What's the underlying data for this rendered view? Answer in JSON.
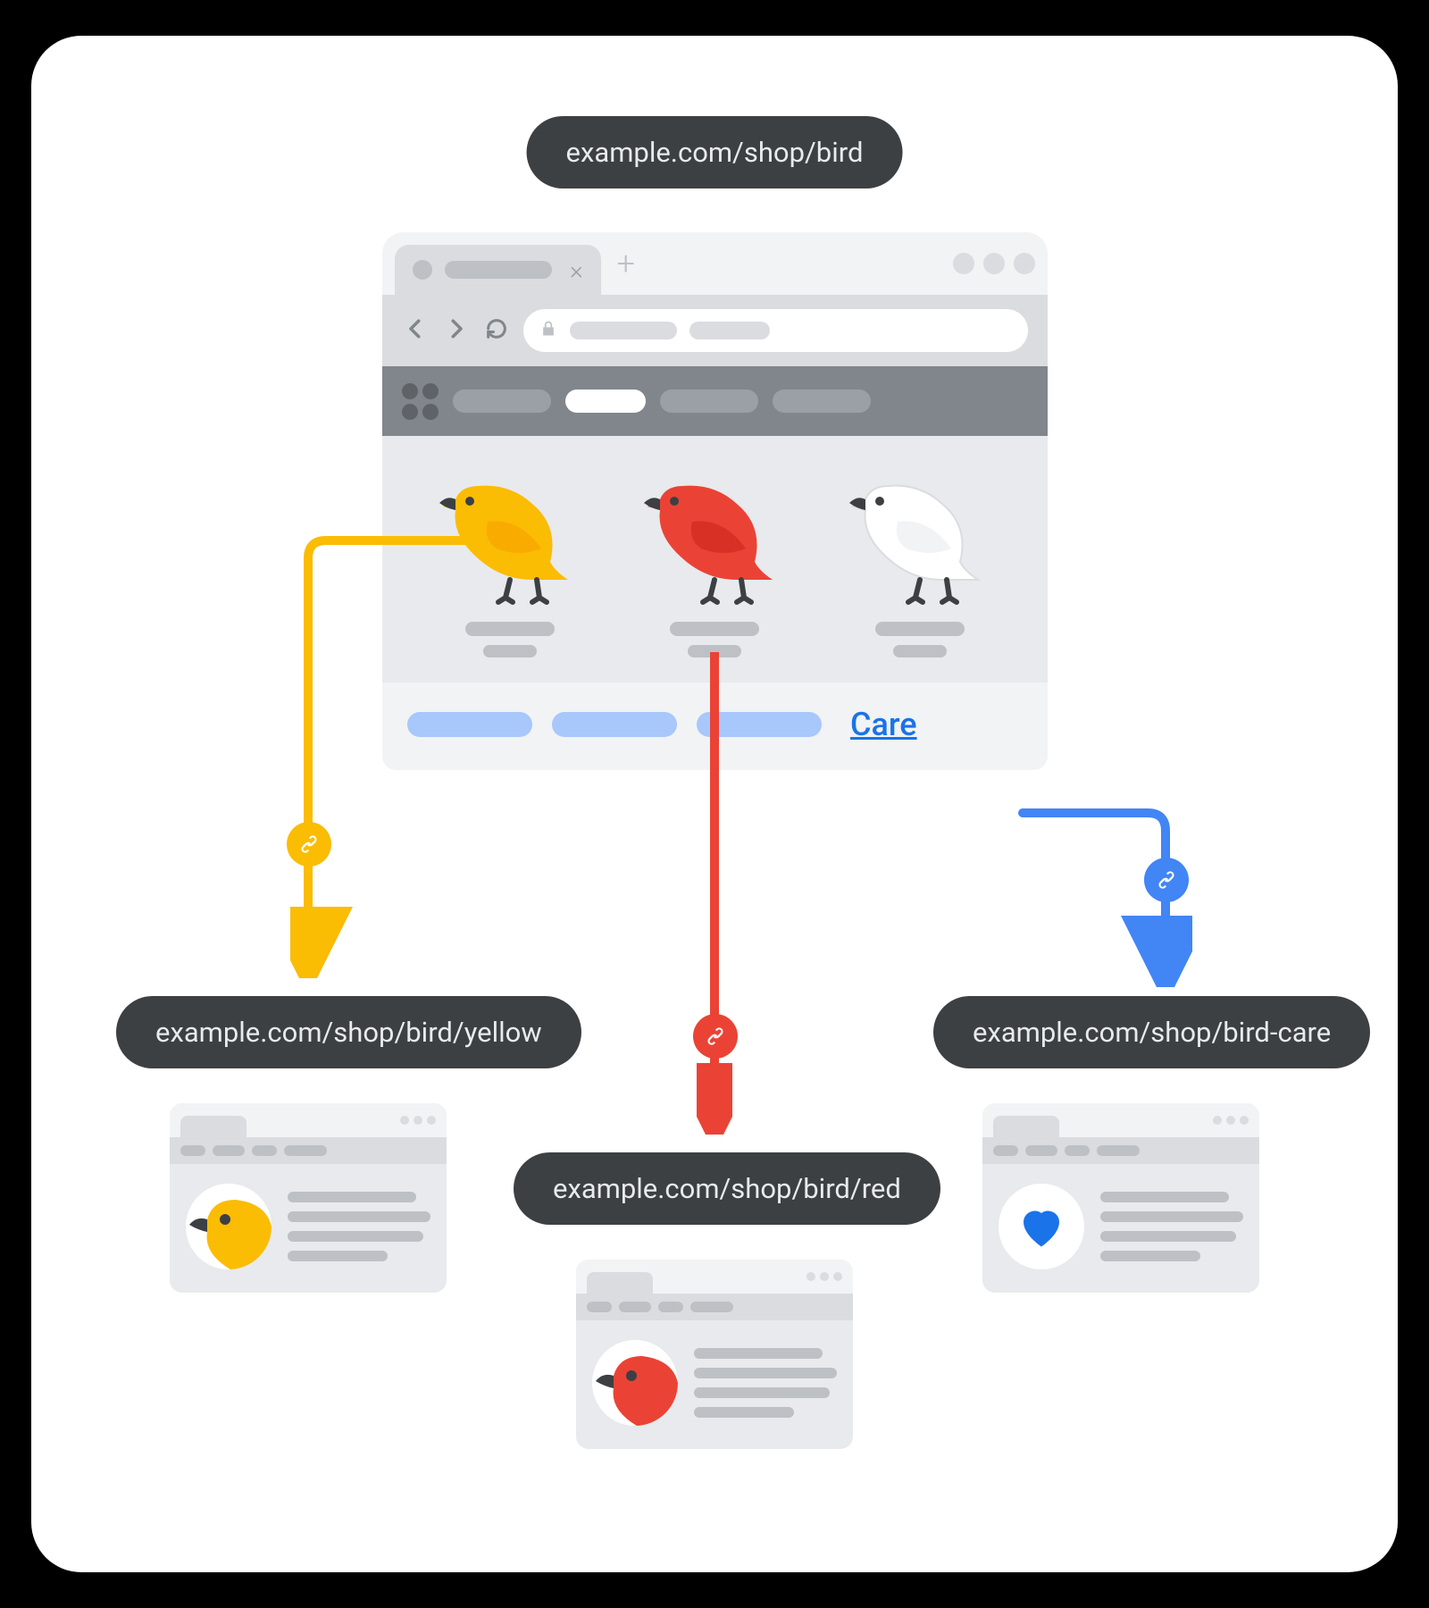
{
  "main_url": "example.com/shop/bird",
  "care_link_label": "Care",
  "birds": {
    "yellow": {
      "body": "#fbbc04",
      "wing": "#f9ab00",
      "url": "example.com/shop/bird/yellow"
    },
    "red": {
      "body": "#ea4335",
      "wing": "#d93025",
      "url": "example.com/shop/bird/red"
    },
    "white": {
      "body": "#ffffff",
      "wing": "#f1f3f4"
    }
  },
  "care_url": "example.com/shop/bird-care",
  "colors": {
    "yellow_arrow": "#fbbc04",
    "red_arrow": "#ea4335",
    "blue_arrow": "#4285f4",
    "heart": "#1a73e8"
  }
}
